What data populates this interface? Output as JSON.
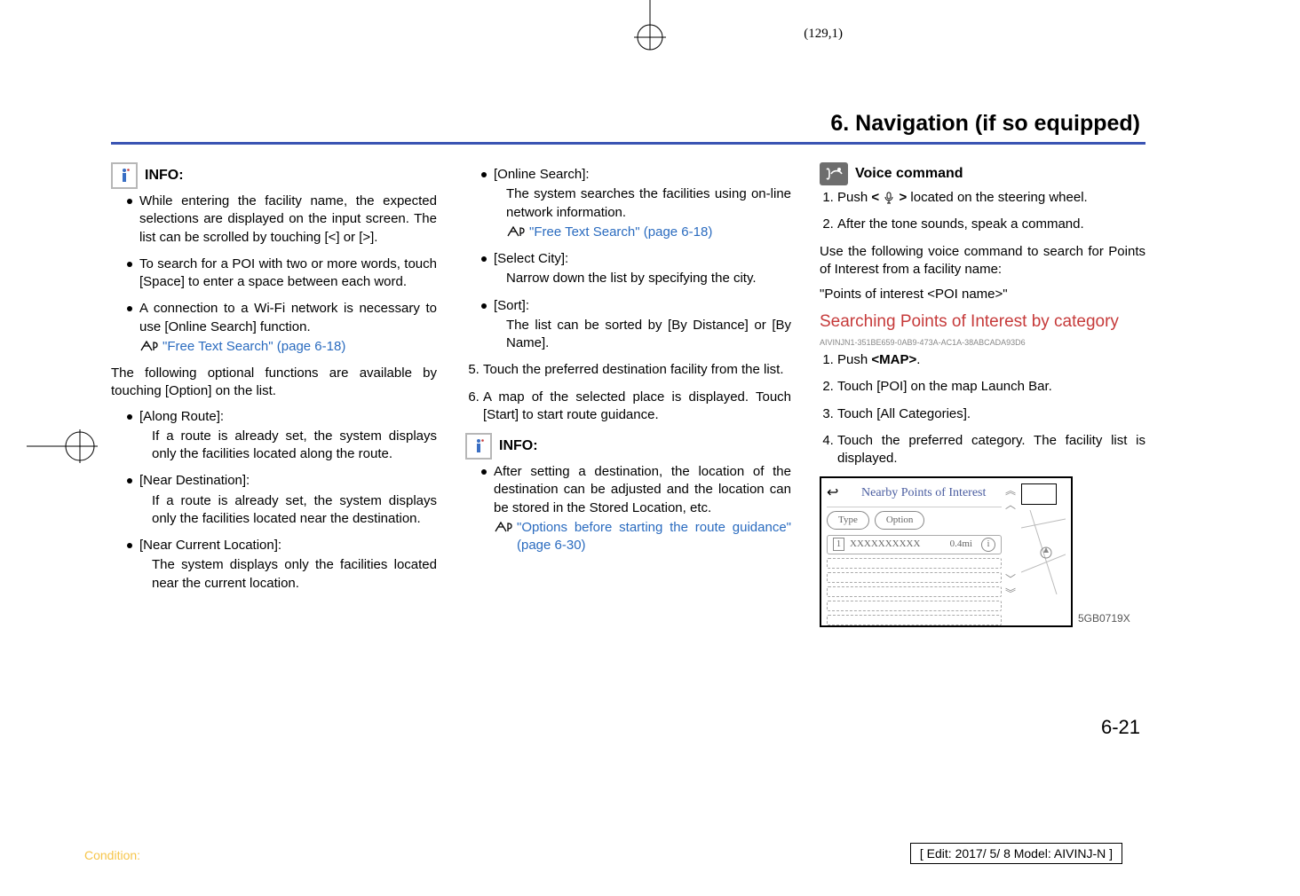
{
  "header": {
    "coord": "(129,1)",
    "chapter": "6. Navigation (if so equipped)"
  },
  "info_label": "INFO:",
  "voice_label": "Voice command",
  "col1": {
    "b1": "While entering the facility name, the expected selections are displayed on the input screen. The list can be scrolled by touching [<] or [>].",
    "b2": "To search for a POI with two or more words, touch [Space] to enter a space between each word.",
    "b3": "A connection to a Wi-Fi network is necessary to use [Online Search] function.",
    "ref1": "\"Free Text Search\" (page 6-18)",
    "para1": "The following optional functions are available by touching [Option] on the list.",
    "opt1_t": "[Along Route]:",
    "opt1_b": "If a route is already set, the system displays only the facilities located along the route.",
    "opt2_t": "[Near Destination]:",
    "opt2_b": "If a route is already set, the system displays only the facilities located near the destination.",
    "opt3_t": "[Near Current Location]:",
    "opt3_b": "The system displays only the facilities located near the current location."
  },
  "col2": {
    "opt4_t": "[Online Search]:",
    "opt4_b": "The system searches the facilities using on-line network information.",
    "ref2": "\"Free Text Search\" (page 6-18)",
    "opt5_t": "[Select City]:",
    "opt5_b": "Narrow down the list by specifying the city.",
    "opt6_t": "[Sort]:",
    "opt6_b": "The list can be sorted by [By Distance] or [By Name].",
    "step5": "Touch the preferred destination facility from the list.",
    "step6": "A map of the selected place is displayed. Touch [Start] to start route guidance.",
    "info2_b": "After setting a destination, the location of the destination can be adjusted and the location can be stored in the Stored Location, etc.",
    "ref3": "\"Options before starting the route guidance\" (page 6-30)"
  },
  "col3": {
    "v1a": "Push ",
    "v1b": " located on the steering wheel.",
    "lt": "<",
    "gt": ">",
    "v2": "After the tone sounds, speak a command.",
    "p1": "Use the following voice command to search for Points of Interest from a facility name:",
    "p2": "\"Points of interest <POI name>\"",
    "subhead": "Searching Points of Interest by category",
    "guid": "AIVINJN1-351BE659-0AB9-473A-AC1A-38ABCADA93D6",
    "s1a": "Push ",
    "s1b": "<MAP>",
    "s1c": ".",
    "s2": "Touch [POI] on the map Launch Bar.",
    "s3": "Touch [All Categories].",
    "s4": "Touch the preferred category. The facility list is displayed.",
    "thumb": {
      "title": "Nearby Points of Interest",
      "pill1": "Type",
      "pill2": "Option",
      "item": "XXXXXXXXXX",
      "dist": "0.4mi",
      "label": "5GB0719X"
    }
  },
  "footer": {
    "pageNum": "6-21",
    "condition": "Condition:",
    "edit": "[ Edit: 2017/ 5/ 8    Model:  AIVINJ-N ]"
  }
}
